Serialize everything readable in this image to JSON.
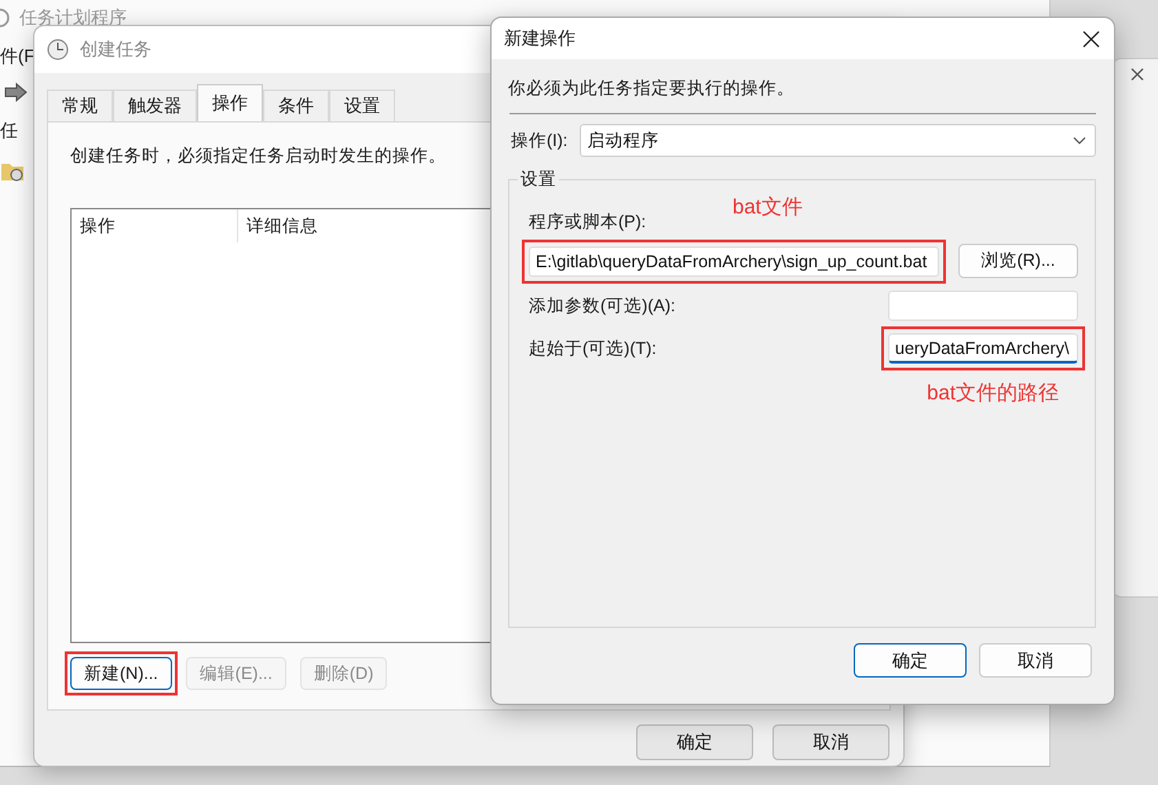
{
  "background_window": {
    "title": "任务计划程序",
    "menu": "件(F",
    "tree_item": "任"
  },
  "create_task_window": {
    "title": "创建任务",
    "tabs": [
      {
        "label": "常规",
        "selected": false
      },
      {
        "label": "触发器",
        "selected": false
      },
      {
        "label": "操作",
        "selected": true
      },
      {
        "label": "条件",
        "selected": false
      },
      {
        "label": "设置",
        "selected": false
      }
    ],
    "description": "创建任务时，必须指定任务启动时发生的操作。",
    "table": {
      "columns": [
        "操作",
        "详细信息"
      ]
    },
    "buttons": [
      {
        "label": "新建(N)...",
        "disabled": false,
        "highlighted": true
      },
      {
        "label": "编辑(E)...",
        "disabled": true,
        "highlighted": false
      },
      {
        "label": "删除(D)",
        "disabled": true,
        "highlighted": false
      }
    ],
    "footer_buttons": [
      "确定",
      "取消"
    ]
  },
  "new_action_dialog": {
    "title": "新建操作",
    "instruction": "你必须为此任务指定要执行的操作。",
    "action": {
      "label": "操作(I):",
      "value": "启动程序"
    },
    "group": {
      "title": "设置",
      "fields": [
        {
          "kind": "stacked",
          "label": "程序或脚本(P):",
          "value": "E:\\gitlab\\queryDataFromArchery\\sign_up_count.bat",
          "button": "浏览(R)...",
          "highlighted": true,
          "focused": false,
          "annotation": "bat文件"
        },
        {
          "kind": "inline",
          "label": "添加参数(可选)(A):",
          "highlighted": false,
          "focused": false
        },
        {
          "kind": "inline",
          "label": "起始于(可选)(T):",
          "value": "ueryDataFromArchery\\",
          "highlighted": true,
          "focused": true,
          "annotation": "bat文件的路径"
        }
      ]
    },
    "footer_buttons": [
      {
        "label": "确定",
        "default": true
      },
      {
        "label": "取消",
        "default": false
      }
    ]
  }
}
